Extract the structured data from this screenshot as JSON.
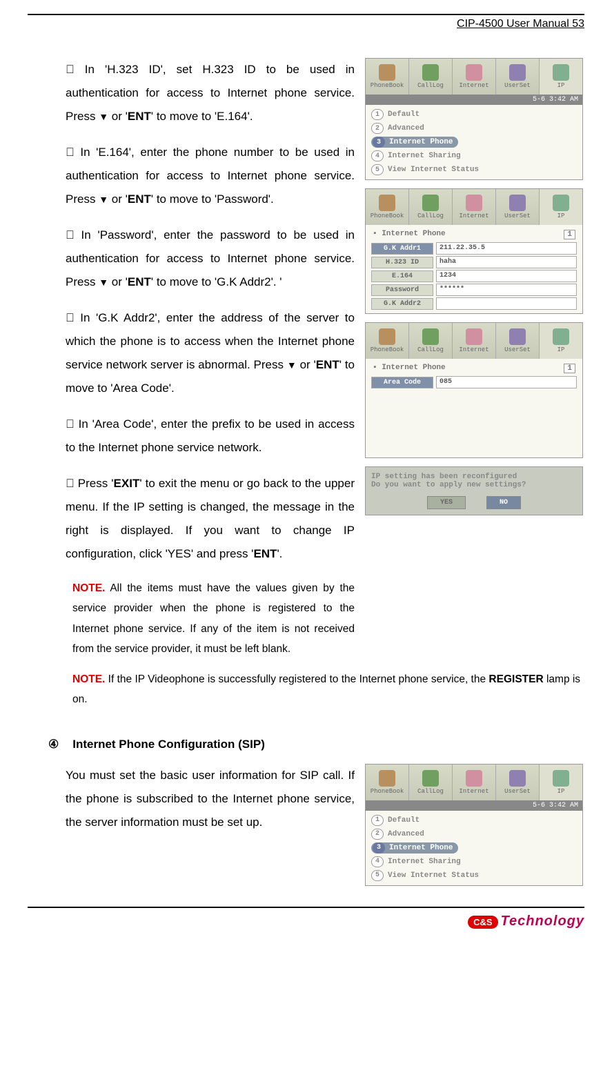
{
  "header": {
    "title": "CIP-4500 User Manual 53"
  },
  "paragraphs": {
    "p1_a": "In 'H.323 ID', set H.323 ID to be used in authentication for access to Internet phone service. Press ",
    "p1_b": " or '",
    "p1_c": "' to move to 'E.164'.",
    "p2_a": "In 'E.164', enter the phone number to be used in authentication for access to Internet phone service. Press ",
    "p2_b": " or '",
    "p2_c": "' to move to 'Password'.",
    "p3_a": "In 'Password', enter the password to be used in authentication for access to Internet phone service. Press ",
    "p3_b": " or '",
    "p3_c": "' to move to 'G.K Addr2'. '",
    "p4_a": "In 'G.K Addr2', enter the address of the server to which the phone is to access when the Internet phone service network server is abnormal. Press ",
    "p4_b": " or '",
    "p4_c": "' to move to 'Area Code'.",
    "p5": "In 'Area Code', enter the prefix to be used in access to the Internet phone service network.",
    "p6_a": "Press '",
    "p6_b": "' to exit the menu or go back to the upper menu. If the IP setting is changed, the message in the right is displayed. If you want to change IP configuration, click 'YES' and press '",
    "p6_c": "'.",
    "ent": "ENT",
    "exit": "EXIT",
    "down": "▼",
    "bullet": "󾠯"
  },
  "notes": {
    "label": "NOTE.",
    "n1": " All the items must have the values given by the service provider when the phone is registered to the Internet phone service. If any of the item is not received from the service provider, it must be left blank.",
    "n2_a": " If the IP Videophone is successfully registered to the Internet phone service, the ",
    "n2_b": " lamp is on.",
    "register": "REGISTER"
  },
  "section2": {
    "num": "④",
    "heading": "Internet Phone Configuration (SIP)",
    "text": "You must set the basic user information for SIP call. If the phone is subscribed to the Internet phone service, the server information must be set up."
  },
  "screenshots": {
    "toolbar": {
      "tabs": [
        "PhoneBook",
        "CallLog",
        "Internet",
        "UserSet",
        "IP"
      ]
    },
    "statusbar": "5-6  3:42 AM",
    "menu": {
      "items": [
        "Default",
        "Advanced",
        "Internet Phone",
        "Internet Sharing",
        "View Internet Status"
      ],
      "selected_index": 2
    },
    "form1": {
      "title": "Internet Phone",
      "page": "1",
      "rows": [
        {
          "label": "G.K Addr1",
          "value": "211.22.35.5",
          "sel": true
        },
        {
          "label": "H.323 ID",
          "value": "haha",
          "sel": false
        },
        {
          "label": "E.164",
          "value": "1234",
          "sel": false
        },
        {
          "label": "Password",
          "value": "******",
          "sel": false
        },
        {
          "label": "G.K Addr2",
          "value": "",
          "sel": false
        }
      ]
    },
    "form2": {
      "title": "Internet Phone",
      "page": "1",
      "rows": [
        {
          "label": "Area Code",
          "value": "085",
          "sel": true
        }
      ]
    },
    "dialog": {
      "text": "IP setting has been reconfigured\nDo you want to apply new settings?",
      "yes": "YES",
      "no": "NO"
    }
  },
  "footer": {
    "badge": "C&S",
    "brand": "Technology"
  }
}
